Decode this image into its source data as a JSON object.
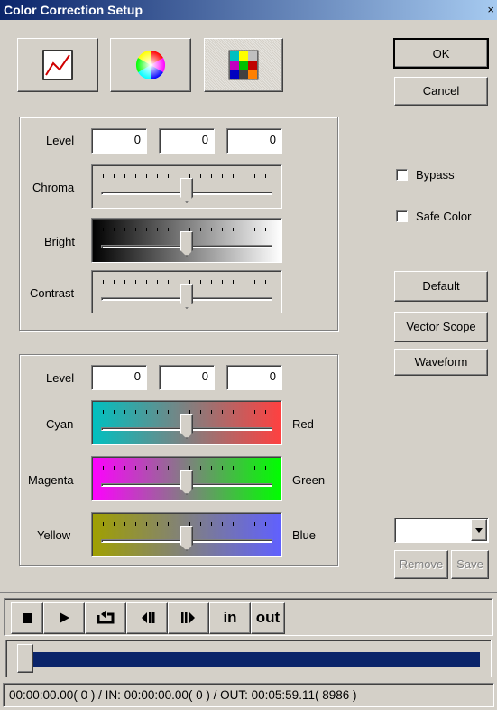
{
  "window": {
    "title": "Color Correction Setup",
    "close": "×"
  },
  "dialog": {
    "ok": "OK",
    "cancel": "Cancel",
    "default": "Default",
    "vector_scope": "Vector Scope",
    "waveform": "Waveform",
    "remove": "Remove",
    "save": "Save"
  },
  "options": {
    "bypass": "Bypass",
    "safe_color": "Safe Color",
    "bypass_checked": false,
    "safe_color_checked": false
  },
  "luma": {
    "level_label": "Level",
    "level_values": [
      "0",
      "0",
      "0"
    ],
    "chroma_label": "Chroma",
    "chroma_value": 0.5,
    "bright_label": "Bright",
    "bright_value": 0.5,
    "contrast_label": "Contrast",
    "contrast_value": 0.5
  },
  "color": {
    "level_label": "Level",
    "level_values": [
      "0",
      "0",
      "0"
    ],
    "rows": [
      {
        "left": "Cyan",
        "right": "Red",
        "value": 0.5,
        "from": "#00c0c0",
        "to": "#ff4040"
      },
      {
        "left": "Magenta",
        "right": "Green",
        "value": 0.5,
        "from": "#ff00ff",
        "to": "#00ff00"
      },
      {
        "left": "Yellow",
        "right": "Blue",
        "value": 0.5,
        "from": "#a0a000",
        "to": "#6060ff"
      }
    ]
  },
  "transport": {
    "in": "in",
    "out": "out",
    "position": 0.0
  },
  "status": {
    "text": "00:00:00.00( 0 ) / IN: 00:00:00.00( 0 ) / OUT: 00:05:59.11( 8986 )"
  },
  "colors": {
    "title_start": "#0a246a",
    "title_end": "#a6caf0",
    "progress": "#0a246a"
  }
}
